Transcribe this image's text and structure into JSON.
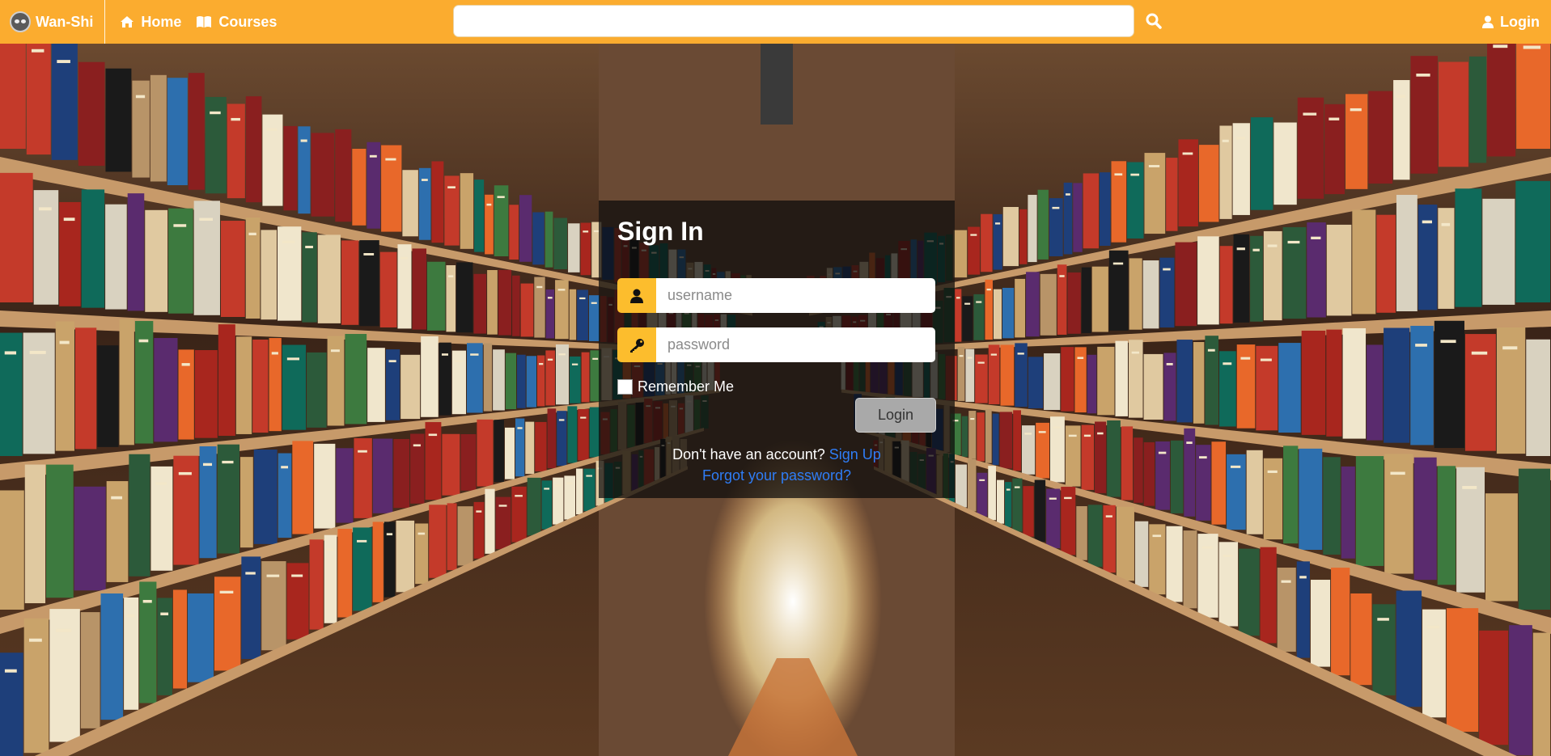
{
  "navbar": {
    "brand": "Wan-Shi",
    "links": [
      {
        "label": "Home",
        "icon": "home-icon"
      },
      {
        "label": "Courses",
        "icon": "book-icon"
      }
    ],
    "search": {
      "value": "",
      "placeholder": ""
    },
    "login": {
      "label": "Login",
      "icon": "user-icon"
    },
    "color": "#fbac2f"
  },
  "signin": {
    "title": "Sign In",
    "username_placeholder": "username",
    "password_placeholder": "password",
    "remember_label": "Remember Me",
    "login_button": "Login",
    "no_account_text": "Don't have an account?",
    "signup_link": "Sign Up",
    "forgot_link": "Forgot your password?",
    "accent": "#fcbd2d",
    "link_color": "#2f7df6"
  },
  "background": {
    "description_icon": "library-bookshelves-image"
  }
}
